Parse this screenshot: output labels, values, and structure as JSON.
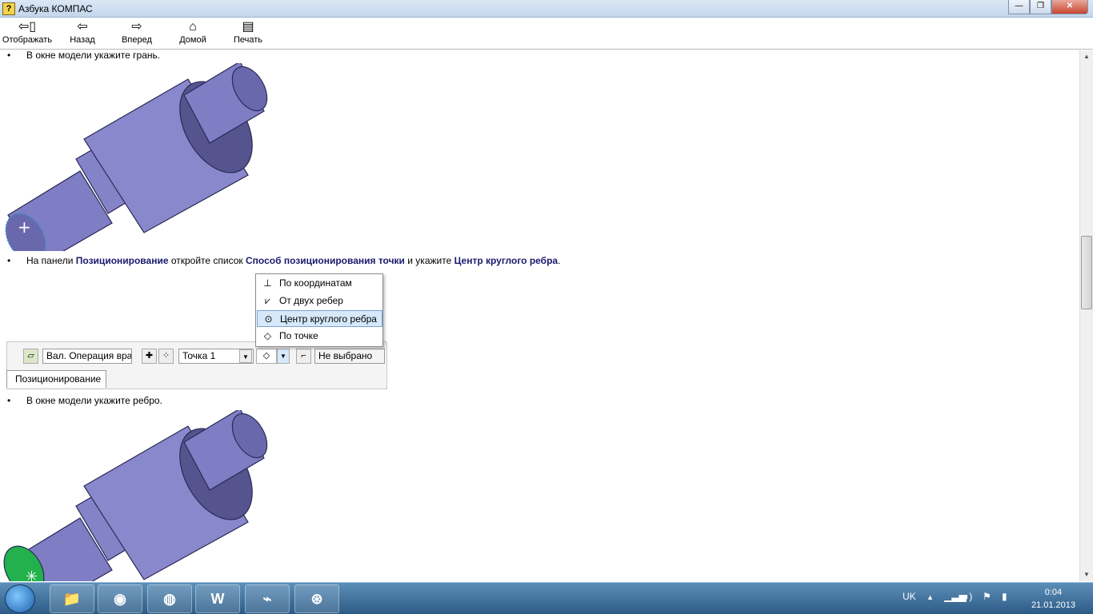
{
  "window": {
    "title": "Азбука КОМПАС",
    "minimize": "—",
    "restore": "❐",
    "close": "✕"
  },
  "toolbar": [
    {
      "label": "Отображать",
      "icon": "show-icon"
    },
    {
      "label": "Назад",
      "icon": "back-arrow-icon"
    },
    {
      "label": "Вперед",
      "icon": "forward-arrow-icon"
    },
    {
      "label": "Домой",
      "icon": "home-icon"
    },
    {
      "label": "Печать",
      "icon": "print-icon"
    }
  ],
  "content": {
    "step1": "В окне модели укажите грань.",
    "step2": {
      "prefix": "На панели ",
      "b1": "Позиционирование",
      "mid1": " откройте список ",
      "b2": "Способ позиционирования точки",
      "mid2": " и укажите ",
      "b3": "Центр круглого ребра",
      "suffix": "."
    },
    "step3": "В окне модели укажите ребро.",
    "bullet": "•"
  },
  "panel": {
    "operation_field": "Вал. Операция вра",
    "point_field": "Точка 1",
    "status_field": "Не выбрано",
    "tab": "Позиционирование"
  },
  "dropdown": {
    "items": [
      {
        "label": "По координатам",
        "icon": "coordinates-icon"
      },
      {
        "label": "От двух ребер",
        "icon": "two-edges-icon"
      },
      {
        "label": "Центр круглого ребра",
        "icon": "circle-center-icon",
        "selected": true
      },
      {
        "label": "По точке",
        "icon": "point-icon"
      }
    ]
  },
  "taskbar": {
    "apps": [
      "explorer",
      "chrome",
      "firefox",
      "word",
      "acrobat",
      "kompas"
    ],
    "word_label": "W",
    "lang": "UK",
    "time": "0:04",
    "date": "21.01.2013"
  },
  "colors": {
    "shaft": "#8a88cc",
    "shaft_dark": "#56548f",
    "highlight": "#22b14c"
  }
}
